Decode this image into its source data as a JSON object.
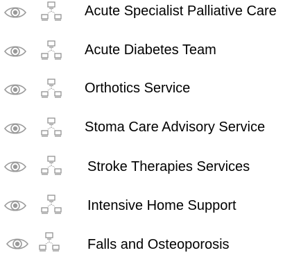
{
  "services": [
    {
      "name": "Acute Specialist Palliative Care",
      "view_icon": "eye-icon",
      "type_icon": "network-icon"
    },
    {
      "name": "Acute Diabetes Team",
      "view_icon": "eye-icon",
      "type_icon": "network-icon"
    },
    {
      "name": "Orthotics Service",
      "view_icon": "eye-icon",
      "type_icon": "network-icon"
    },
    {
      "name": "Stoma Care Advisory Service",
      "view_icon": "eye-icon",
      "type_icon": "network-icon"
    },
    {
      "name": "Stroke Therapies Services",
      "view_icon": "eye-icon",
      "type_icon": "network-icon"
    },
    {
      "name": "Intensive Home Support",
      "view_icon": "eye-icon",
      "type_icon": "network-icon"
    },
    {
      "name": "Falls and Osteoporosis",
      "view_icon": "eye-icon",
      "type_icon": "network-icon"
    }
  ],
  "colors": {
    "icon_gray": "#9a9a9a",
    "text": "#000000",
    "background": "#ffffff"
  }
}
